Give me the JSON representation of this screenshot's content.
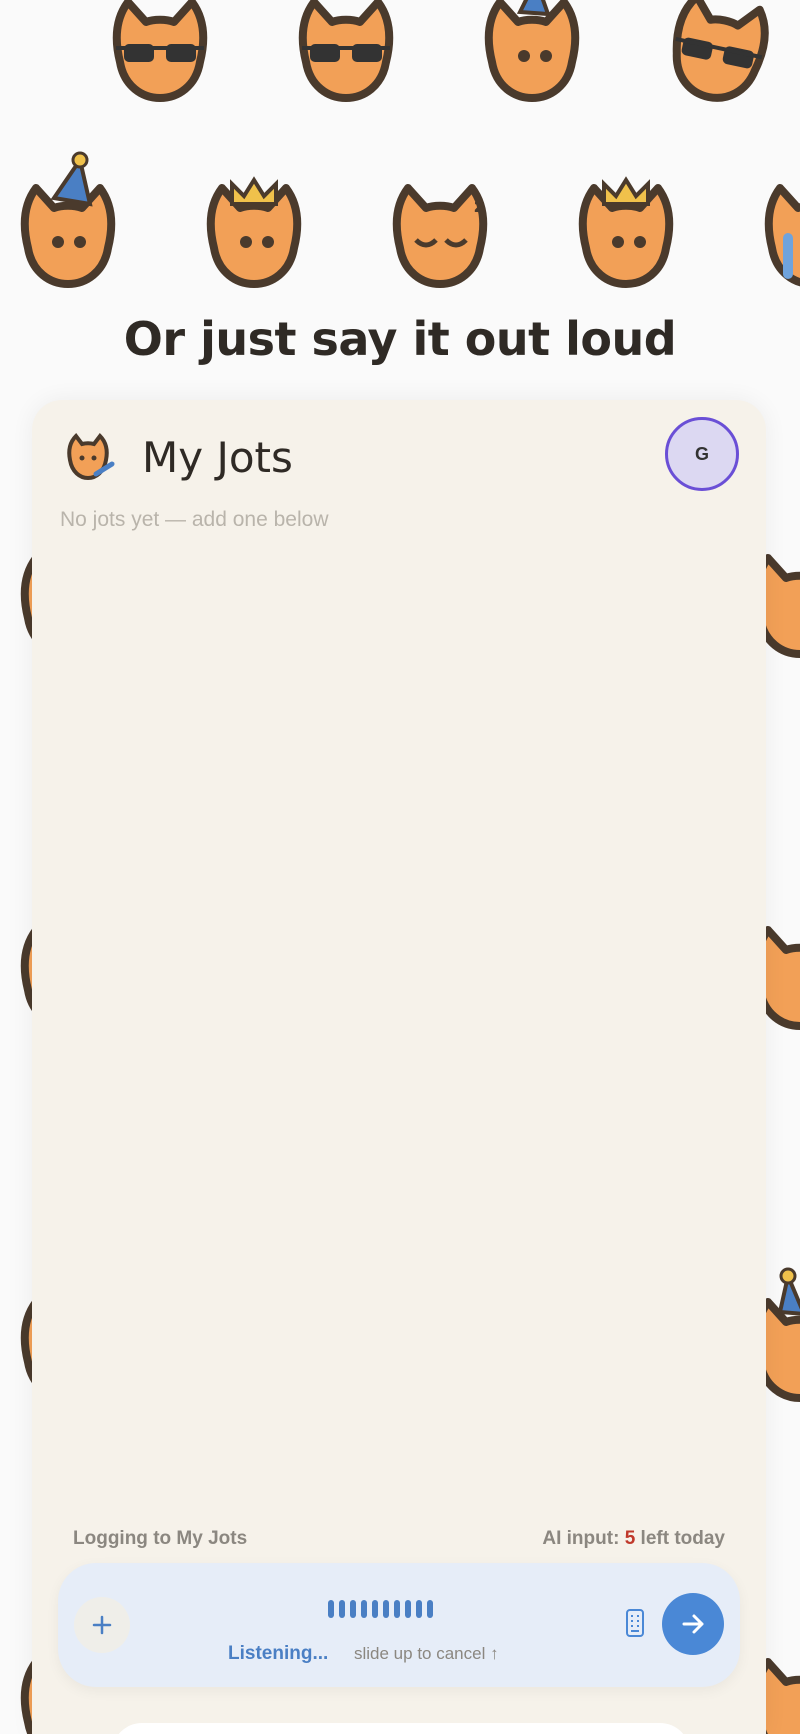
{
  "headline": "Or just say it out loud",
  "app": {
    "title": "My Jots",
    "avatar_initial": "G",
    "empty_message": "No jots yet — add one below"
  },
  "footer": {
    "logging_label": "Logging to My Jots",
    "ai_prefix": "AI input: ",
    "ai_count": "5",
    "ai_suffix": " left today"
  },
  "input_bar": {
    "status": "Listening...",
    "hint": "slide up to cancel ↑",
    "plus_icon": "plus-icon",
    "keyboard_icon": "keyboard-icon",
    "send_icon": "arrow-right-icon"
  },
  "colors": {
    "accent": "#4a88d6",
    "cat_fill": "#f2a057",
    "cat_outline": "#4a3a2c",
    "card_bg": "#f6f2ea",
    "avatar_ring": "#6a4fd6",
    "ai_count": "#c0392b"
  }
}
